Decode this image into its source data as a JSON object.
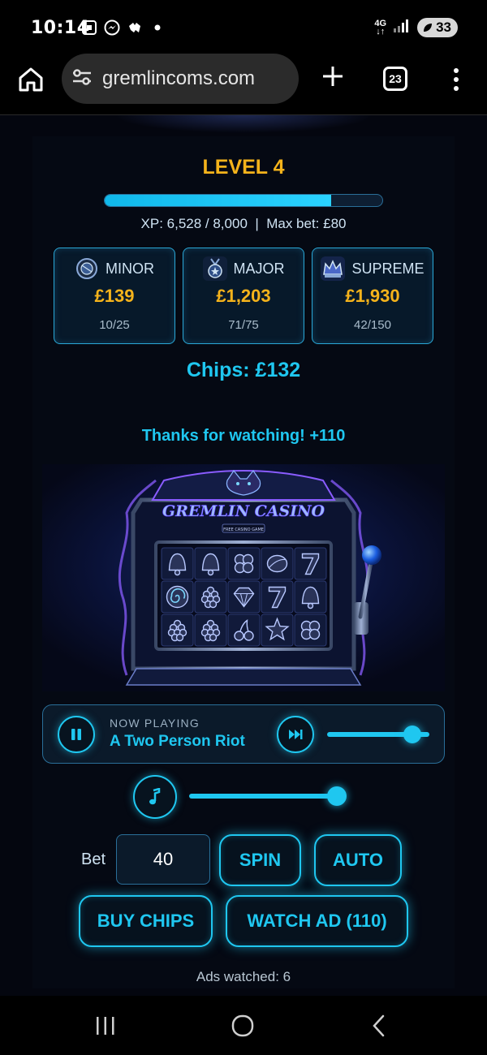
{
  "status_bar": {
    "time": "10:14",
    "network": "4G",
    "battery": "33",
    "icons": [
      "screenshot-icon",
      "messenger-icon",
      "game-icon",
      "dot-icon",
      "signal-icon",
      "battery-icon"
    ]
  },
  "browser": {
    "url": "gremlincoms.com",
    "tab_count": "23"
  },
  "game": {
    "level": "LEVEL 4",
    "xp_progress": 0.816,
    "xp_line": "XP: 6,528 / 8,000  |  Max bet: £80",
    "jackpots": [
      {
        "name": "MINOR",
        "value": "£139",
        "count": "10/25",
        "icon": "coin-icon"
      },
      {
        "name": "MAJOR",
        "value": "£1,203",
        "count": "71/75",
        "icon": "medal-icon"
      },
      {
        "name": "SUPREME",
        "value": "£1,930",
        "count": "42/150",
        "icon": "crown-icon"
      }
    ],
    "chips": "Chips: £132",
    "message": "Thanks for watching! +110",
    "machine_title": "GREMLIN CASINO",
    "machine_subtitle": "FREE CASINO GAME",
    "reels": [
      "bell",
      "bell",
      "clover",
      "ball",
      "seven",
      "swirl",
      "grapes",
      "diamond",
      "seven",
      "bell",
      "grapes",
      "grapes",
      "cherry",
      "star",
      "clover"
    ]
  },
  "player": {
    "now_playing_label": "NOW PLAYING",
    "song": "A Two Person Riot",
    "track_progress": 0.83,
    "volume": 0.95
  },
  "controls": {
    "bet_label": "Bet",
    "bet_value": "40",
    "spin": "SPIN",
    "auto": "AUTO",
    "buy_chips": "BUY CHIPS",
    "watch_ad": "WATCH AD (110)",
    "ads_watched": "Ads watched: 6"
  },
  "colors": {
    "accent": "#1fc7f0",
    "gold": "#f5b31b",
    "background": "#04060f"
  }
}
